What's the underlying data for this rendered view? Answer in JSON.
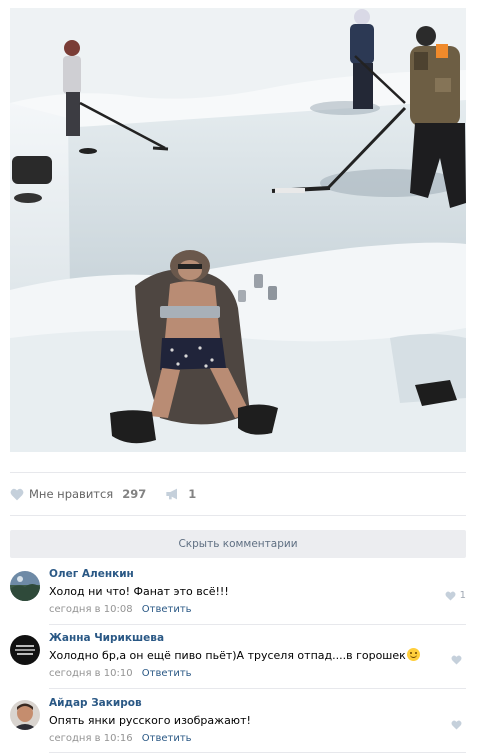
{
  "post": {
    "image_alt": "Мужчина в шапке-ушанке загорает на снегу у хоккейной площадки",
    "likes_label": "Мне нравится",
    "likes_count": "297",
    "shares_count": "1"
  },
  "comments_toggle": "Скрыть комментарии",
  "comments": [
    {
      "author": "Олег Аленкин",
      "text": "Холод ни что! Фанат это всё!!!",
      "date": "сегодня в 10:08",
      "reply": "Ответить",
      "likes": "1"
    },
    {
      "author": "Жанна Чирикшева",
      "text": "Холодно бр,а он ещё пиво пьёт)А труселя отпад....в горошек",
      "date": "сегодня в 10:10",
      "reply": "Ответить",
      "likes": ""
    },
    {
      "author": "Айдар Закиров",
      "text": "Опять янки русского изображают!",
      "date": "сегодня в 10:16",
      "reply": "Ответить",
      "likes": ""
    }
  ],
  "colors": {
    "link": "#2a5885",
    "muted": "#939393",
    "bar_bg": "#ecedf0"
  }
}
